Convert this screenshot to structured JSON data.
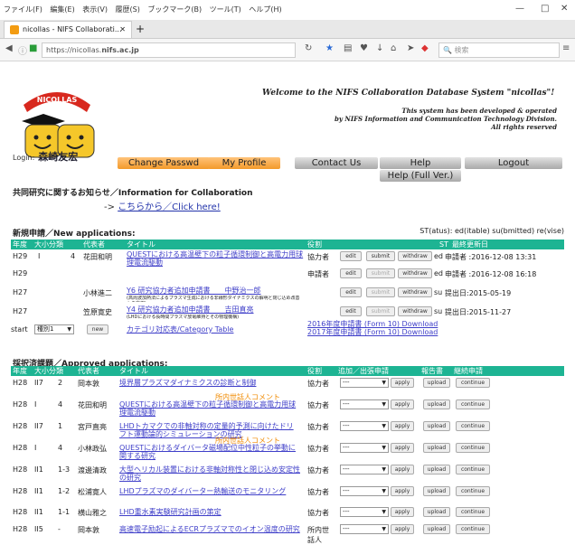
{
  "browser": {
    "menus": [
      "ファイル(F)",
      "編集(E)",
      "表示(V)",
      "履歴(S)",
      "ブックマーク(B)",
      "ツール(T)",
      "ヘルプ(H)"
    ],
    "tab_title": "nicollas - NIFS Collaborati...",
    "url_prefix": "https://nicollas.",
    "url_domain": "nifs.ac.jp",
    "search_placeholder": "検索"
  },
  "header": {
    "logo_text": "NICOLLAS",
    "welcome": "Welcome to the NIFS Collaboration Database System \"nicollas\"!",
    "credit_lines": [
      "This system has been developed & operated",
      "by NIFS Information and Communication Technology Division.",
      "All rights reserved"
    ],
    "login_label": "Login:",
    "login_user": "森崎友宏"
  },
  "nav": {
    "change_passwd": "Change Passwd",
    "my_profile": "My Profile",
    "contact_us": "Contact Us",
    "help": "Help",
    "logout": "Logout",
    "help_full": "Help (Full Ver.)"
  },
  "collab": {
    "title": "共同研究に関するお知らせ／Information for Collaboration",
    "arrow": "->",
    "link": "こちらから／Click here!"
  },
  "new_apps": {
    "title": "新規申請／New applications:",
    "legend": "ST(atus): ed(itable) su(bmitted) re(vise)",
    "headers": {
      "year": "年度",
      "cat": "大小分類",
      "rep": "代表者",
      "title": "タイトル",
      "role": "役割",
      "st": "ST",
      "updated": "最終更新日"
    },
    "rows": [
      {
        "year": "H29",
        "cat1": "I",
        "cat2": "4",
        "rep": "花田和明",
        "title": "QUESTにおける高温壁下の粒子循環制御と高電力用球理電流駆動",
        "role": "協力者",
        "st": "ed",
        "date": "申請者 :2016-12-08 13:31",
        "buttons": [
          "edit",
          "submit",
          "withdraw"
        ],
        "submit_disabled": false
      },
      {
        "year": "H29",
        "cat1": "",
        "cat2": "",
        "rep": "",
        "title": "",
        "role": "申請者",
        "st": "ed",
        "date": "申請者 :2016-12-08 16:18",
        "buttons": [
          "edit",
          "submit",
          "withdraw"
        ],
        "submit_disabled": true
      },
      {
        "year": "H27",
        "cat1": "",
        "cat2": "",
        "rep": "小林進二",
        "title": "Y6 研究協力者追加申請書　　中野治一郎",
        "subtitle": "(高周波加熱法によるプラズマ生成における非線形ダイナミクスの解明と閉じ込め改善への応用)",
        "role": "",
        "st": "su",
        "date": "提出日:2015-05-19",
        "buttons": [
          "edit",
          "submit",
          "withdraw"
        ],
        "submit_disabled": true
      },
      {
        "year": "H27",
        "cat1": "",
        "cat2": "",
        "rep": "笠原寛史",
        "title": "Y4 研究協力者追加申請書　　吉田直亮",
        "subtitle": "(LHDにおける長時間プラズマ放電維持とその物理機構)",
        "role": "",
        "st": "su",
        "date": "提出日:2015-11-27",
        "buttons": [
          "edit",
          "submit",
          "withdraw"
        ],
        "submit_disabled": true
      }
    ],
    "start_label": "start",
    "start_select": "種別1",
    "new_btn": "new",
    "cat_link": "カテゴリ対応表/Category Table",
    "form_links": [
      "2016年度申請書 (Form 10) Download",
      "2017年度申請書 (Form 10) Download"
    ]
  },
  "approved": {
    "title": "採択済課題／Approved applications:",
    "headers": {
      "year": "年度",
      "cat": "大小分類",
      "rep": "代表者",
      "title": "タイトル",
      "role": "役割",
      "add": "追加／出張申請",
      "report": "報告書",
      "cont": "継続申請"
    },
    "rows": [
      {
        "year": "H28",
        "cat1": "II7",
        "cat2": "2",
        "rep": "岡本敦",
        "title": "境界層プラズマダイナミクスの診断と制御",
        "note": "",
        "role": "協力者"
      },
      {
        "year": "H28",
        "cat1": "I",
        "cat2": "4",
        "rep": "花田和明",
        "title": "QUESTにおける高温壁下の粒子循環制御と高電力用球理電流駆動",
        "note": "所内世話人コメント",
        "role": "協力者"
      },
      {
        "year": "H28",
        "cat1": "II7",
        "cat2": "1",
        "rep": "宮戸直亮",
        "title": "LHDトカマクでの非軸対称の定量的予測に向けたドリフト運動論的シミュレーションの研究",
        "note": "",
        "role": "協力者"
      },
      {
        "year": "H28",
        "cat1": "I",
        "cat2": "4",
        "rep": "小林政弘",
        "title": "QUESTにおけるダイバータ磁場配位中性粒子の挙動に関する研究",
        "note": "所内世話人コメント",
        "role": "協力者"
      },
      {
        "year": "H28",
        "cat1": "II1",
        "cat2": "1-3",
        "rep": "渡邊清政",
        "title": "大型ヘリカル装置における非軸対称性と閉じ込め安定性の研究",
        "note": "",
        "role": "協力者"
      },
      {
        "year": "H28",
        "cat1": "II1",
        "cat2": "1-2",
        "rep": "松浦寛人",
        "title": "LHDプラズマのダイバーター熱輸送のモニタリング",
        "note": "",
        "role": "協力者"
      },
      {
        "year": "H28",
        "cat1": "II1",
        "cat2": "1-1",
        "rep": "横山雅之",
        "title": "LHD重水素実験研究計画の策定",
        "note": "",
        "role": "協力者"
      },
      {
        "year": "H28",
        "cat1": "II5",
        "cat2": "-",
        "rep": "岡本敦",
        "title": "高速電子励起によるECRプラズマでのイオン温度の研究",
        "note": "",
        "role": "所内世話人"
      }
    ],
    "select_value": "---",
    "apply": "apply",
    "upload": "upload",
    "continue": "continue"
  }
}
